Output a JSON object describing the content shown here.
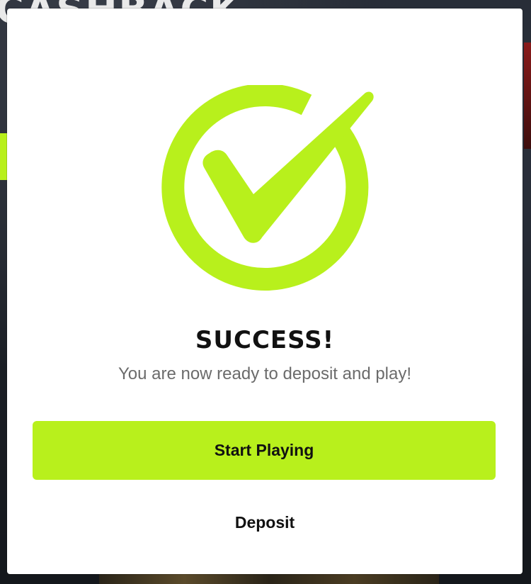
{
  "background": {
    "banner_text": "CASHBACK"
  },
  "modal": {
    "icon": "checkmark-circle-icon",
    "accent_color": "#b8f01c",
    "title": "SUCCESS!",
    "subtitle": "You are now ready to deposit and play!",
    "primary_button_label": "Start Playing",
    "secondary_button_label": "Deposit"
  }
}
